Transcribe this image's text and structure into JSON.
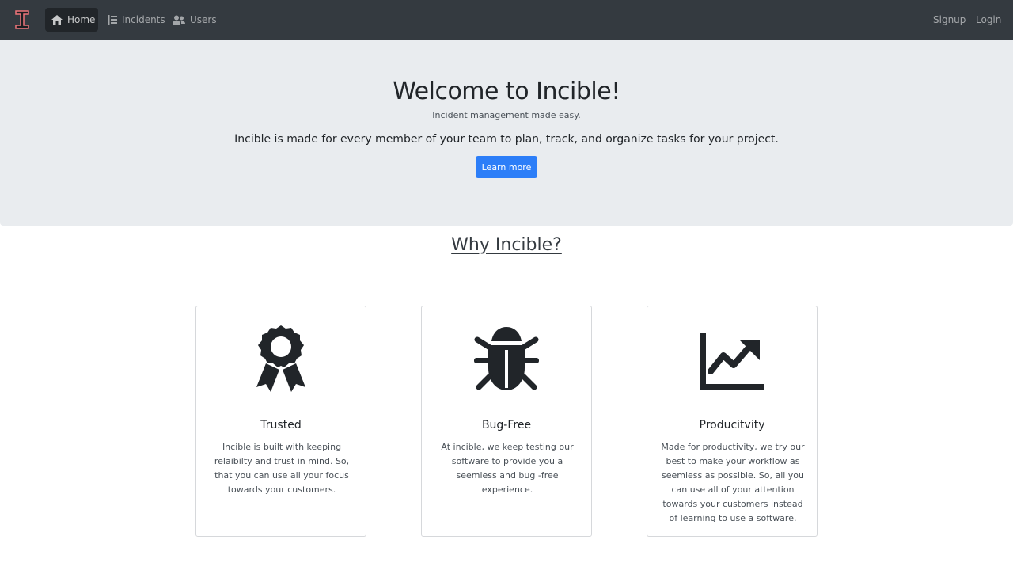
{
  "navbar": {
    "brand_icon": "incible-logo-icon",
    "items": [
      {
        "label": "Home",
        "icon": "home-icon",
        "active": true
      },
      {
        "label": "Incidents",
        "icon": "list-icon",
        "active": false
      },
      {
        "label": "Users",
        "icon": "users-icon",
        "active": false
      }
    ],
    "signup_label": "Signup",
    "login_label": "Login"
  },
  "hero": {
    "title": "Welcome to Incible!",
    "subtitle": "Incident management made easy.",
    "lead": "Incible is made for every member of your team to plan, track, and organize tasks for your project.",
    "button_label": "Learn more"
  },
  "why": {
    "heading": "Why Incible?"
  },
  "features": [
    {
      "icon": "award-icon",
      "title": "Trusted",
      "text": "Incible is built with keeping relaibilty and trust in mind. So, that you can use all your focus towards your customers."
    },
    {
      "icon": "bug-icon",
      "title": "Bug-Free",
      "text": "At incible, we keep testing our software to provide you a seemless and bug -free experience."
    },
    {
      "icon": "chart-line-icon",
      "title": "Producitvity",
      "text": "Made for productivity, we try our best to make your workflow as seemless as possible. So, all you can use all of your attention towards your customers instead of learning to use a software."
    }
  ],
  "colors": {
    "navbar_bg": "#343a40",
    "hero_bg": "#e9ecef",
    "primary": "#2c7ef8",
    "brand": "#f0757a"
  }
}
